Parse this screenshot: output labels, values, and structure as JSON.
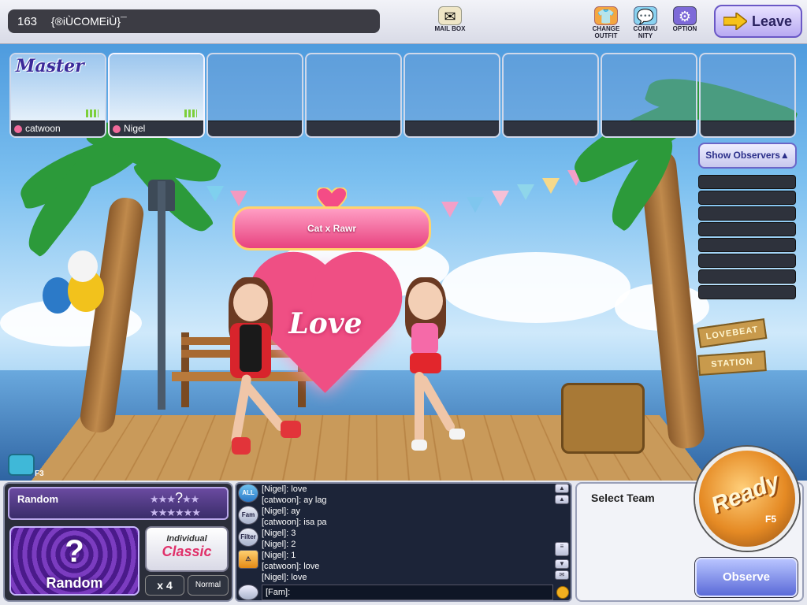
{
  "room": {
    "number": "163",
    "title": "{®iÙCOMEiÙ}¯"
  },
  "top_menu": {
    "mailbox": "MAIL BOX",
    "change_outfit_1": "CHANGE",
    "change_outfit_2": "OUTFIT",
    "community_1": "COMMU",
    "community_2": "NITY",
    "option": "OPTION",
    "leave": "Leave"
  },
  "players": [
    {
      "name": "catwoon",
      "badge": "Master"
    },
    {
      "name": "Nigel"
    }
  ],
  "observers": {
    "button": "Show Observers▲",
    "rows": 8
  },
  "couple": {
    "name": "Cat x Rawr",
    "effect": "Love"
  },
  "scene": {
    "sign_1": "LOVEBEAT",
    "sign_2": "STATION"
  },
  "camera": {
    "key": "F3"
  },
  "song": {
    "title": "Random",
    "difficulty_glyph": "?"
  },
  "mode": {
    "random_card": "Random",
    "random_glyph": "?",
    "individual": "Individual",
    "classic": "Classic",
    "speed": "x 4",
    "difficulty": "Normal"
  },
  "chat": {
    "tabs": [
      "ALL",
      "Fam",
      "Filter"
    ],
    "lines": [
      "[Nigel]: love",
      "[catwoon]: ay lag",
      "[Nigel]: ay",
      "[catwoon]: isa pa",
      "[Nigel]: 3",
      "[Nigel]: 2",
      "[Nigel]: 1",
      "[catwoon]: love",
      "[Nigel]: love"
    ],
    "input_prefix": "[Fam]:"
  },
  "team": {
    "label": "Select Team"
  },
  "ready": {
    "label": "Ready",
    "key": "F5"
  },
  "observe": {
    "label": "Observe"
  }
}
